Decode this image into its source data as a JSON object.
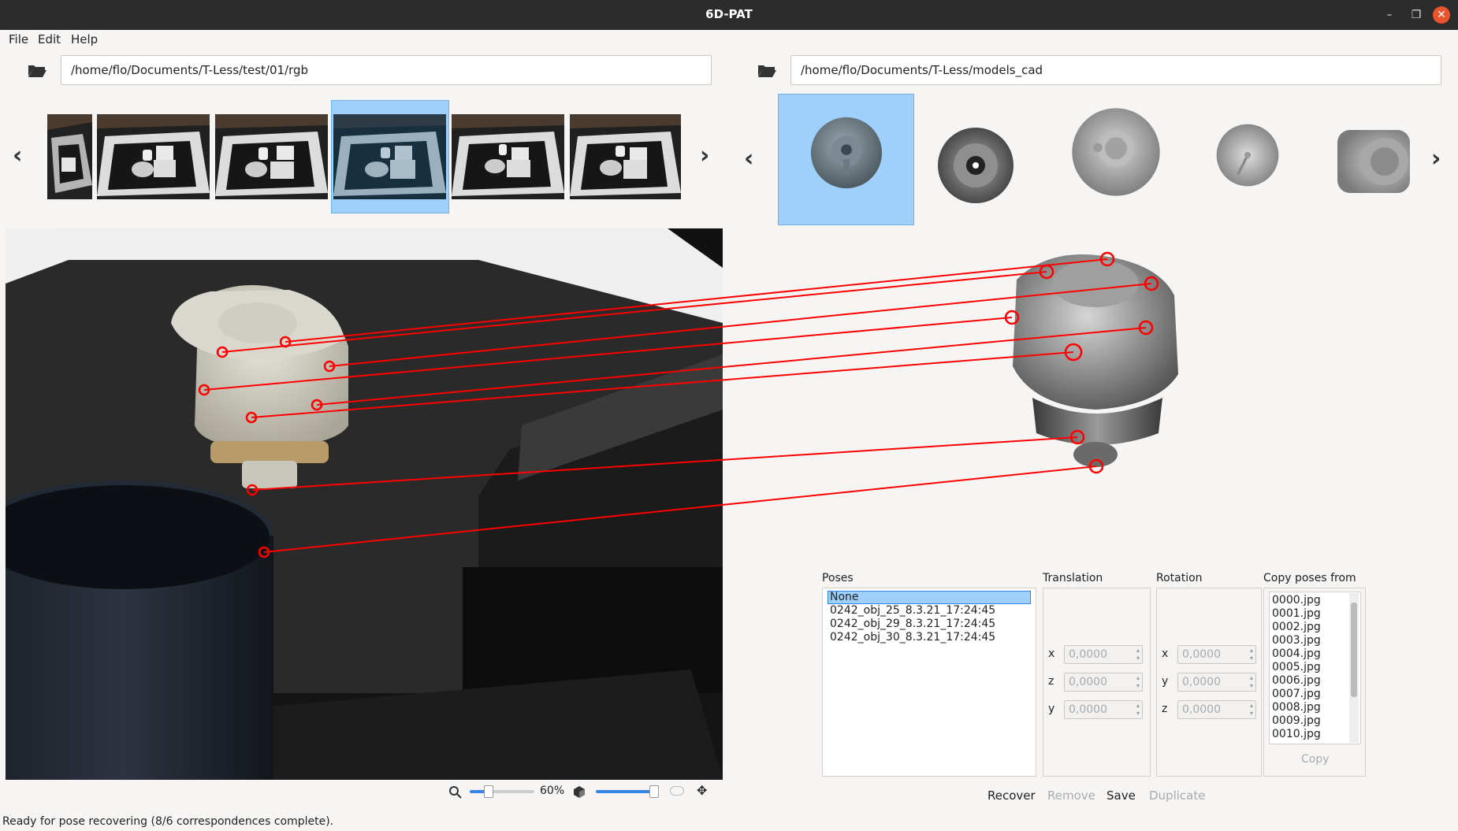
{
  "window": {
    "title": "6D-PAT"
  },
  "menu": {
    "file": "File",
    "edit": "Edit",
    "help": "Help"
  },
  "left_path": "/home/flo/Documents/T-Less/test/01/rgb",
  "right_path": "/home/flo/Documents/T-Less/models_cad",
  "image_thumbs": [
    "image-thumb-1",
    "image-thumb-2",
    "image-thumb-3",
    "image-thumb-4-selected",
    "image-thumb-5",
    "image-thumb-6"
  ],
  "model_thumbs": [
    "model-thumb-1-selected",
    "model-thumb-2",
    "model-thumb-3",
    "model-thumb-4",
    "model-thumb-5"
  ],
  "poses": {
    "label": "Poses",
    "items": [
      "None",
      "0242_obj_25_8.3.21_17:24:45",
      "0242_obj_29_8.3.21_17:24:45",
      "0242_obj_30_8.3.21_17:24:45"
    ],
    "selected": "None"
  },
  "translation": {
    "label": "Translation",
    "fields": [
      {
        "axis": "x",
        "value": "0,0000"
      },
      {
        "axis": "z",
        "value": "0,0000"
      },
      {
        "axis": "y",
        "value": "0,0000"
      }
    ]
  },
  "rotation": {
    "label": "Rotation",
    "fields": [
      {
        "axis": "x",
        "value": "0,0000"
      },
      {
        "axis": "y",
        "value": "0,0000"
      },
      {
        "axis": "z",
        "value": "0,0000"
      }
    ]
  },
  "copy_poses": {
    "label": "Copy poses from",
    "items": [
      "0000.jpg",
      "0001.jpg",
      "0002.jpg",
      "0003.jpg",
      "0004.jpg",
      "0005.jpg",
      "0006.jpg",
      "0007.jpg",
      "0008.jpg",
      "0009.jpg",
      "0010.jpg"
    ],
    "button": "Copy"
  },
  "actions": {
    "recover": "Recover",
    "remove": "Remove",
    "save": "Save",
    "duplicate": "Duplicate"
  },
  "zoom": {
    "value": 0.6,
    "label": "60%"
  },
  "opacity": {
    "value": 1.0
  },
  "status": "Ready for pose recovering (8/6 correspondences complete).",
  "colors": {
    "selection": "#9fd0fb",
    "correspondence": "#ff0000",
    "titlebar": "#2c2c2c",
    "close": "#e9542f"
  }
}
